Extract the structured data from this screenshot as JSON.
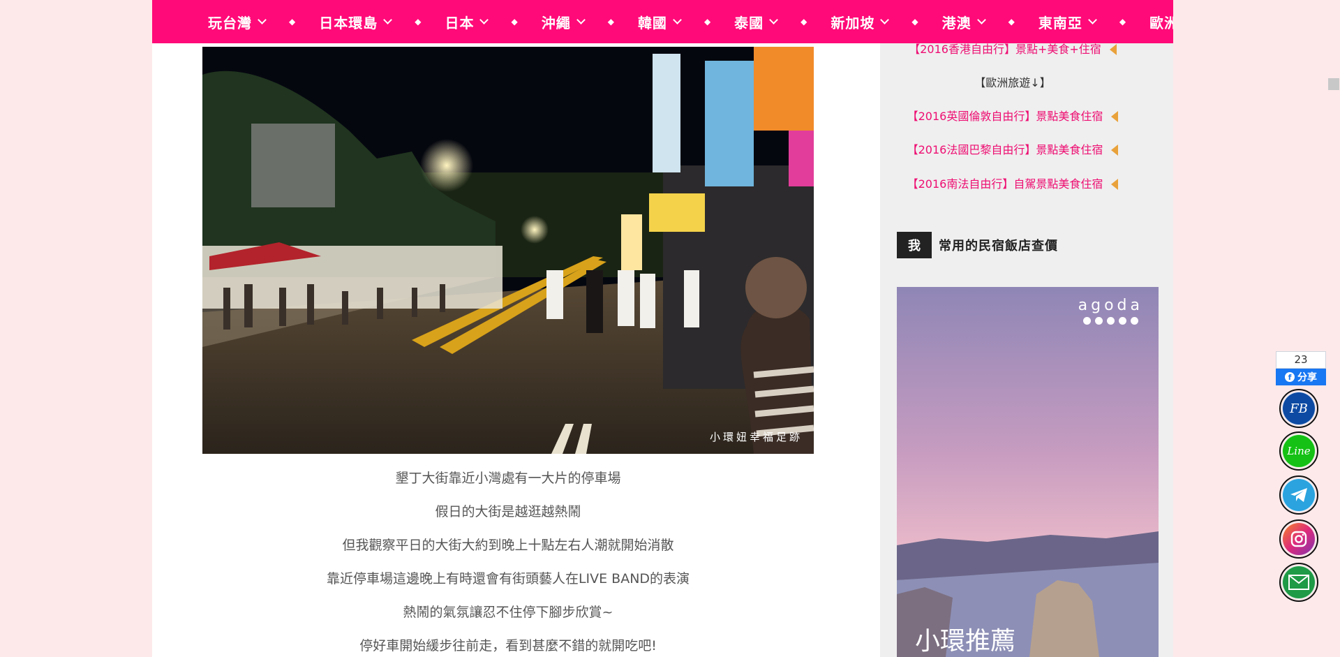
{
  "nav": {
    "items": [
      {
        "label": "玩台灣"
      },
      {
        "label": "日本環島"
      },
      {
        "label": "日本"
      },
      {
        "label": "沖繩"
      },
      {
        "label": "韓國"
      },
      {
        "label": "泰國"
      },
      {
        "label": "新加坡"
      },
      {
        "label": "港澳"
      },
      {
        "label": "東南亞"
      },
      {
        "label": "歐洲"
      }
    ],
    "separator": "◆"
  },
  "main": {
    "photo_watermark": "小環妞幸福足跡",
    "lines": [
      "墾丁大街靠近小灣處有一大片的停車場",
      "假日的大街是越逛越熱鬧",
      "但我觀察平日的大街大約到晚上十點左右人潮就開始消散",
      "靠近停車場這邊晚上有時還會有街頭藝人在LIVE BAND的表演",
      "熱鬧的氣氛讓忍不住停下腳步欣賞~",
      "停好車開始緩步往前走，看到甚麼不錯的就開吃吧!"
    ]
  },
  "sidebar": {
    "link_top": "【2016香港自由行】景點+美食+住宿",
    "europe_header": "【歐洲旅遊↓】",
    "links": [
      "【2016英國倫敦自由行】景點美食住宿",
      "【2016法國巴黎自由行】景點美食住宿",
      "【2016南法自由行】自駕景點美食住宿"
    ],
    "section_badge": "我",
    "section_title": "常用的民宿飯店查價",
    "ad": {
      "logo": "agoda",
      "text": "小環推薦"
    }
  },
  "share": {
    "count": "23",
    "button_label": "分享",
    "fb_glyph": "f"
  },
  "social": [
    {
      "label": "FB",
      "color": "#0d4aa3",
      "icon": "facebook-icon"
    },
    {
      "label": "Line",
      "color": "#14c114",
      "icon": "line-icon"
    },
    {
      "label": "",
      "color": "#2aa3df",
      "icon": "telegram-icon"
    },
    {
      "label": "",
      "color": "#d62976",
      "icon": "instagram-icon"
    },
    {
      "label": "@",
      "color": "#1f9a46",
      "icon": "email-icon"
    }
  ],
  "colors": {
    "brand": "#ff0a78",
    "link": "#ee0e72",
    "page_bg": "#fde9ea"
  }
}
